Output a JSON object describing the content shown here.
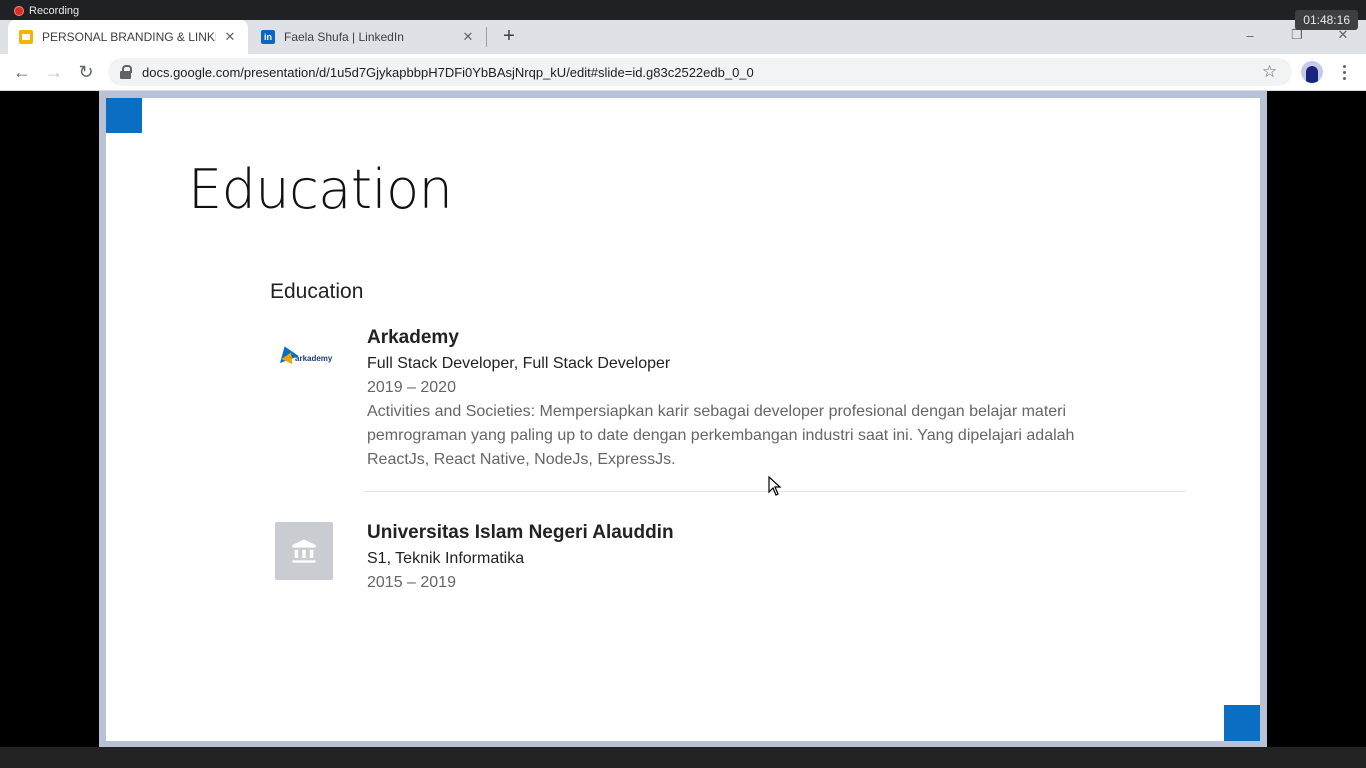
{
  "recording": {
    "label": "Recording",
    "time": "01:48:16"
  },
  "tabs": [
    {
      "title": "PERSONAL BRANDING & LINKEDIN",
      "icon": "google-slides-icon",
      "active": true
    },
    {
      "title": "Faela Shufa | LinkedIn",
      "icon": "linkedin-icon",
      "active": false
    }
  ],
  "newtab": {
    "symbol": "+"
  },
  "window_controls": {
    "minimize": "–",
    "restore": "❐",
    "close": "✕"
  },
  "toolbar": {
    "back": "←",
    "forward": "→",
    "reload": "↻",
    "url": "docs.google.com/presentation/d/1u5d7GjykapbbpH7DFi0YbBAsjNrqp_kU/edit#slide=id.g83c2522edb_0_0",
    "bookmark": "☆"
  },
  "slide": {
    "title": "Education",
    "section_heading": "Education",
    "accent_color": "#0a6fc2",
    "entries": [
      {
        "school": "Arkademy",
        "logo_text": "arkademy",
        "degree": "Full Stack Developer, Full Stack Developer",
        "dates": "2019 – 2020",
        "description": "Activities and Societies: Mempersiapkan karir sebagai developer profesional dengan belajar materi pemrograman yang paling up to date dengan perkembangan industri saat ini. Yang dipelajari adalah ReactJs, React Native, NodeJs, ExpressJs."
      },
      {
        "school": "Universitas Islam Negeri Alauddin",
        "logo_icon": "institution-icon",
        "degree": "S1, Teknik Informatika",
        "dates": "2015 – 2019"
      }
    ]
  }
}
